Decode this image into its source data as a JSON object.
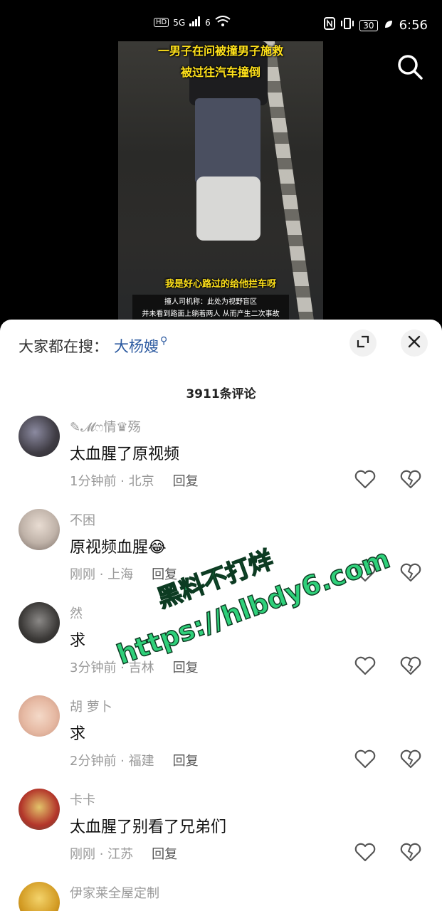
{
  "status_bar": {
    "network": "5G",
    "wifi_badge": "6",
    "hd_badge": "HD",
    "battery": "30",
    "time": "6:56"
  },
  "video": {
    "caption_top_1": "一男子在问被撞男子施救",
    "caption_top_2": "被过往汽车撞倒",
    "caption_speech": "我是好心路过的给他拦车呀",
    "subtitle_1": "撞人司机称：此处为视野盲区",
    "subtitle_2": "并未看到路面上躺着两人 从而产生二次事故"
  },
  "header_icons": {
    "search": "search-icon"
  },
  "sheet": {
    "hot_search_label": "大家都在搜：",
    "hot_search_term": "大杨嫂",
    "expand_icon": "expand-icon",
    "close_icon": "close-icon",
    "comment_count": "3911条评论"
  },
  "comments": [
    {
      "user": "✎𝓜ෆ情♛殇",
      "text": "太血腥了原视频",
      "time": "1分钟前",
      "location": "北京",
      "reply": "回复"
    },
    {
      "user": "不困",
      "text": "原视频血腥😂",
      "time": "刚刚",
      "location": "上海",
      "reply": "回复"
    },
    {
      "user": "然",
      "text": "求",
      "time": "3分钟前",
      "location": "吉林",
      "reply": "回复"
    },
    {
      "user": "胡 萝卜",
      "text": "求",
      "time": "2分钟前",
      "location": "福建",
      "reply": "回复"
    },
    {
      "user": "卡卡",
      "text": "太血腥了别看了兄弟们",
      "time": "刚刚",
      "location": "江苏",
      "reply": "回复"
    },
    {
      "user": "伊家莱全屋定制",
      "text": "",
      "time": "",
      "location": "",
      "reply": ""
    }
  ],
  "watermark": {
    "line1": "黑料不打烊",
    "line2": "https://hlbdy6.com"
  },
  "colors": {
    "accent_blue": "#2c5aa0",
    "watermark_green": "#2fd07a"
  }
}
